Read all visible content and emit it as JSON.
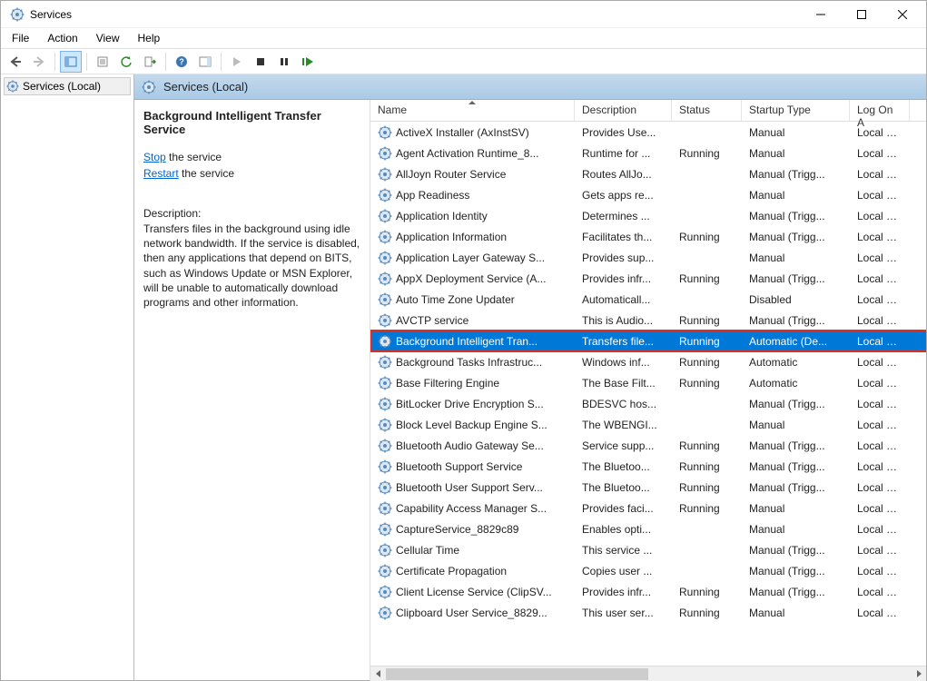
{
  "window": {
    "title": "Services"
  },
  "menubar": {
    "items": [
      "File",
      "Action",
      "View",
      "Help"
    ]
  },
  "tree": {
    "root": "Services (Local)"
  },
  "header_band": {
    "title": "Services (Local)"
  },
  "detail": {
    "service_name": "Background Intelligent Transfer Service",
    "stop_label": "Stop",
    "stop_suffix": " the service",
    "restart_label": "Restart",
    "restart_suffix": " the service",
    "desc_head": "Description:",
    "desc_text": "Transfers files in the background using idle network bandwidth. If the service is disabled, then any applications that depend on BITS, such as Windows Update or MSN Explorer, will be unable to automatically download programs and other information."
  },
  "columns": {
    "name": "Name",
    "description": "Description",
    "status": "Status",
    "startup": "Startup Type",
    "logon": "Log On A"
  },
  "rows": [
    {
      "name": "ActiveX Installer (AxInstSV)",
      "desc": "Provides Use...",
      "status": "",
      "startup": "Manual",
      "logon": "Local Sys"
    },
    {
      "name": "Agent Activation Runtime_8...",
      "desc": "Runtime for ...",
      "status": "Running",
      "startup": "Manual",
      "logon": "Local Sys"
    },
    {
      "name": "AllJoyn Router Service",
      "desc": "Routes AllJo...",
      "status": "",
      "startup": "Manual (Trigg...",
      "logon": "Local Ser"
    },
    {
      "name": "App Readiness",
      "desc": "Gets apps re...",
      "status": "",
      "startup": "Manual",
      "logon": "Local Sys"
    },
    {
      "name": "Application Identity",
      "desc": "Determines ...",
      "status": "",
      "startup": "Manual (Trigg...",
      "logon": "Local Ser"
    },
    {
      "name": "Application Information",
      "desc": "Facilitates th...",
      "status": "Running",
      "startup": "Manual (Trigg...",
      "logon": "Local Sys"
    },
    {
      "name": "Application Layer Gateway S...",
      "desc": "Provides sup...",
      "status": "",
      "startup": "Manual",
      "logon": "Local Ser"
    },
    {
      "name": "AppX Deployment Service (A...",
      "desc": "Provides infr...",
      "status": "Running",
      "startup": "Manual (Trigg...",
      "logon": "Local Sys"
    },
    {
      "name": "Auto Time Zone Updater",
      "desc": "Automaticall...",
      "status": "",
      "startup": "Disabled",
      "logon": "Local Ser"
    },
    {
      "name": "AVCTP service",
      "desc": "This is Audio...",
      "status": "Running",
      "startup": "Manual (Trigg...",
      "logon": "Local Ser"
    },
    {
      "name": "Background Intelligent Tran...",
      "desc": "Transfers file...",
      "status": "Running",
      "startup": "Automatic (De...",
      "logon": "Local Sys",
      "selected": true,
      "highlighted": true
    },
    {
      "name": "Background Tasks Infrastruc...",
      "desc": "Windows inf...",
      "status": "Running",
      "startup": "Automatic",
      "logon": "Local Sys"
    },
    {
      "name": "Base Filtering Engine",
      "desc": "The Base Filt...",
      "status": "Running",
      "startup": "Automatic",
      "logon": "Local Ser"
    },
    {
      "name": "BitLocker Drive Encryption S...",
      "desc": "BDESVC hos...",
      "status": "",
      "startup": "Manual (Trigg...",
      "logon": "Local Sys"
    },
    {
      "name": "Block Level Backup Engine S...",
      "desc": "The WBENGI...",
      "status": "",
      "startup": "Manual",
      "logon": "Local Sys"
    },
    {
      "name": "Bluetooth Audio Gateway Se...",
      "desc": "Service supp...",
      "status": "Running",
      "startup": "Manual (Trigg...",
      "logon": "Local Ser"
    },
    {
      "name": "Bluetooth Support Service",
      "desc": "The Bluetoo...",
      "status": "Running",
      "startup": "Manual (Trigg...",
      "logon": "Local Ser"
    },
    {
      "name": "Bluetooth User Support Serv...",
      "desc": "The Bluetoo...",
      "status": "Running",
      "startup": "Manual (Trigg...",
      "logon": "Local Sys"
    },
    {
      "name": "Capability Access Manager S...",
      "desc": "Provides faci...",
      "status": "Running",
      "startup": "Manual",
      "logon": "Local Sys"
    },
    {
      "name": "CaptureService_8829c89",
      "desc": "Enables opti...",
      "status": "",
      "startup": "Manual",
      "logon": "Local Sys"
    },
    {
      "name": "Cellular Time",
      "desc": "This service ...",
      "status": "",
      "startup": "Manual (Trigg...",
      "logon": "Local Ser"
    },
    {
      "name": "Certificate Propagation",
      "desc": "Copies user ...",
      "status": "",
      "startup": "Manual (Trigg...",
      "logon": "Local Sys"
    },
    {
      "name": "Client License Service (ClipSV...",
      "desc": "Provides infr...",
      "status": "Running",
      "startup": "Manual (Trigg...",
      "logon": "Local Sys"
    },
    {
      "name": "Clipboard User Service_8829...",
      "desc": "This user ser...",
      "status": "Running",
      "startup": "Manual",
      "logon": "Local Sys"
    }
  ]
}
